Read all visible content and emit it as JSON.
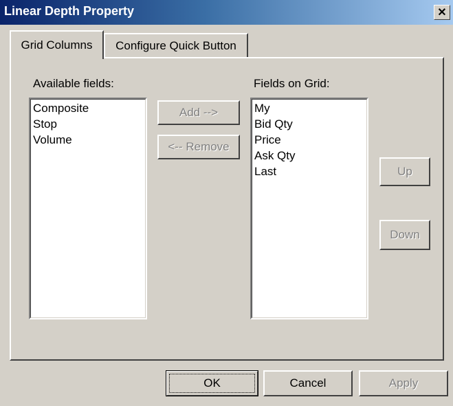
{
  "window": {
    "title": "Linear Depth Property",
    "close_glyph": "✕"
  },
  "tabs": [
    {
      "label": "Grid Columns",
      "active": true
    },
    {
      "label": "Configure Quick Button",
      "active": false
    }
  ],
  "available": {
    "label": "Available fields:",
    "items": [
      "Composite",
      "Stop",
      "Volume"
    ]
  },
  "on_grid": {
    "label": "Fields on Grid:",
    "items": [
      "My",
      "Bid Qty",
      "Price",
      "Ask Qty",
      "Last"
    ]
  },
  "buttons": {
    "add": "Add -->",
    "remove": "<-- Remove",
    "up": "Up",
    "down": "Down",
    "ok": "OK",
    "cancel": "Cancel",
    "apply": "Apply"
  },
  "colors": {
    "face": "#d4d0c8",
    "title_start": "#0a246a",
    "title_end": "#a6caf0",
    "disabled_text": "#808080"
  }
}
